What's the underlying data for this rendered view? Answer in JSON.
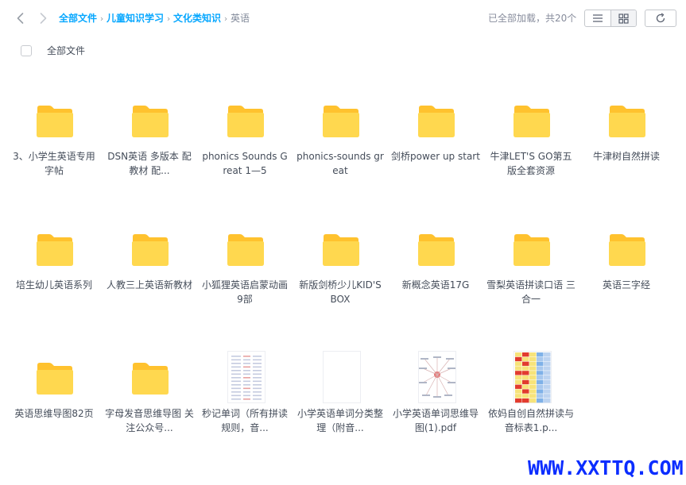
{
  "breadcrumb": {
    "items": [
      "全部文件",
      "儿童知识学习",
      "文化类知识"
    ],
    "current": "英语"
  },
  "status": {
    "loaded_text": "已全部加载，共20个"
  },
  "toolbar": {
    "select_all_label": "全部文件",
    "view_list_icon": "list-icon",
    "view_grid_icon": "grid-icon",
    "refresh_icon": "refresh-icon"
  },
  "colors": {
    "accent": "#06a7ff",
    "folder_back": "#ffc22e",
    "folder_front": "#ffd84f",
    "watermark": "#0b2dff"
  },
  "items": [
    {
      "name": "3、小学生英语专用字帖",
      "type": "folder"
    },
    {
      "name": "DSN英语 多版本 配教材 配...",
      "type": "folder"
    },
    {
      "name": "phonics Sounds Great 1—5",
      "type": "folder"
    },
    {
      "name": "phonics-sounds great",
      "type": "folder"
    },
    {
      "name": "剑桥power up start",
      "type": "folder"
    },
    {
      "name": "牛津LET'S GO第五版全套资源",
      "type": "folder"
    },
    {
      "name": "牛津树自然拼读",
      "type": "folder"
    },
    {
      "name": "培生幼儿英语系列",
      "type": "folder"
    },
    {
      "name": "人教三上英语新教材",
      "type": "folder"
    },
    {
      "name": "小狐狸英语启蒙动画9部",
      "type": "folder"
    },
    {
      "name": "新版剑桥少儿KID'S BOX",
      "type": "folder"
    },
    {
      "name": "新概念英语17G",
      "type": "folder"
    },
    {
      "name": "雪梨英语拼读口语 三合一",
      "type": "folder"
    },
    {
      "name": "英语三字经",
      "type": "folder"
    },
    {
      "name": "英语思维导图82页",
      "type": "folder"
    },
    {
      "name": "字母发音思维导图 关注公众号...",
      "type": "folder"
    },
    {
      "name": "秒记单词（所有拼读规则，音...",
      "type": "doc-list"
    },
    {
      "name": "小学英语单词分类整理（附音...",
      "type": "doc-blank"
    },
    {
      "name": "小学英语单词思维导图(1).pdf",
      "type": "doc-mindmap"
    },
    {
      "name": "依妈自创自然拼读与音标表1.p...",
      "type": "doc-table"
    }
  ],
  "watermark": "WWW.XXTTQ.COM"
}
